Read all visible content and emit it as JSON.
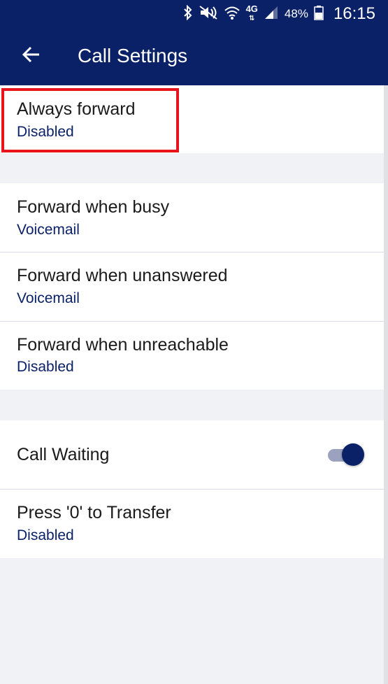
{
  "status_bar": {
    "battery_percent": "48%",
    "time": "16:15",
    "network": "4G",
    "icons": [
      "bluetooth-icon",
      "mute-icon",
      "wifi-icon",
      "network-4g-icon",
      "signal-icon",
      "battery-icon"
    ]
  },
  "app_bar": {
    "title": "Call Settings",
    "back_icon": "arrow-left-icon"
  },
  "forwarding_primary": {
    "items": [
      {
        "label": "Always forward",
        "value": "Disabled"
      }
    ]
  },
  "forwarding_conditional": {
    "items": [
      {
        "label": "Forward when busy",
        "value": "Voicemail"
      },
      {
        "label": "Forward when unanswered",
        "value": "Voicemail"
      },
      {
        "label": "Forward when unreachable",
        "value": "Disabled"
      }
    ]
  },
  "other_settings": {
    "call_waiting": {
      "label": "Call Waiting",
      "enabled": true
    },
    "press_zero": {
      "label": "Press '0' to Transfer",
      "value": "Disabled"
    }
  },
  "colors": {
    "primary": "#0b2167",
    "highlight": "#e8141c",
    "background": "#f1f2f6"
  }
}
